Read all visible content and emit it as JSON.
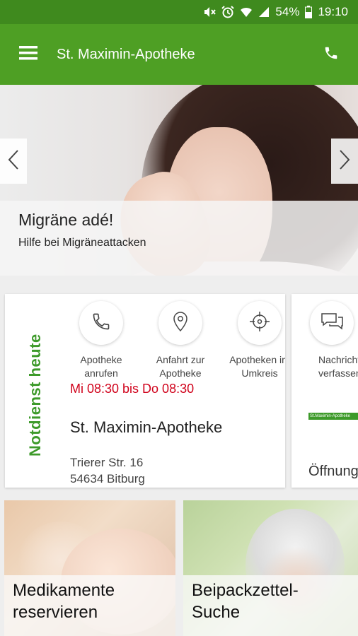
{
  "status_bar": {
    "battery": "54%",
    "time": "19:10",
    "icons": [
      "mute-icon",
      "alarm-icon",
      "wifi-icon",
      "signal-icon",
      "battery-icon"
    ]
  },
  "app_bar": {
    "title": "St. Maximin-Apotheke",
    "left_icon": "menu-icon",
    "right_icon": "phone-icon",
    "color": "#4e9f24"
  },
  "hero": {
    "title": "Migräne adé!",
    "subtitle": "Hilfe bei Migräneattacken"
  },
  "notdienst_card": {
    "vertical_label": "Notdienst heute",
    "actions": [
      {
        "label_line1": "Apotheke",
        "label_line2": "anrufen",
        "icon": "phone-icon"
      },
      {
        "label_line1": "Anfahrt zur",
        "label_line2": "Apotheke",
        "icon": "location-pin-icon"
      },
      {
        "label_line1": "Apotheken im",
        "label_line2": "Umkreis",
        "icon": "crosshair-icon"
      }
    ],
    "hours": "Mi 08:30 bis Do 08:30",
    "pharmacy_name": "St. Maximin-Apotheke",
    "street": "Trierer Str. 16",
    "city": "54634 Bitburg",
    "accent_color": "#3d9a2a",
    "hours_color": "#d0021b"
  },
  "second_card": {
    "action": {
      "label_line1": "Nachricht",
      "label_line2": "verfassen",
      "icon": "chat-bubbles-icon"
    },
    "logo_text": "St.Maximin-Apotheke",
    "heading": "Öffnungszeiten"
  },
  "tiles": [
    {
      "line1": "Medikamente",
      "line2": "reservieren"
    },
    {
      "line1": "Beipackzettel-",
      "line2": "Suche"
    }
  ]
}
